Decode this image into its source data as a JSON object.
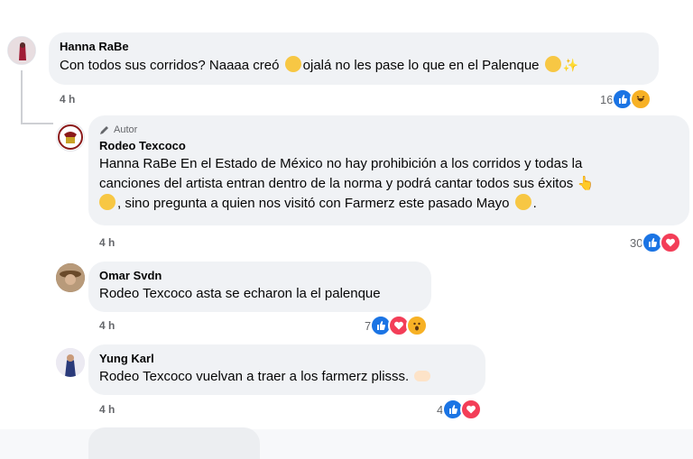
{
  "comments": [
    {
      "name": "Hanna RaBe",
      "text_before_emoji": "Con todos sus corridos? Naaaa creó ",
      "text_after_emoji": "ojalá no les pase lo que en el Palenque ",
      "time": "4 h",
      "reaction_count": "16",
      "reactions": [
        "like-reaction-icon",
        "haha-reaction-icon"
      ]
    },
    {
      "badge": "Autor",
      "name": "Rodeo Texcoco",
      "line1": "Hanna RaBe En el Estado de México no hay prohibición a los corridos y todas la",
      "line2": "canciones del artista entran dentro de la norma y podrá cantar todos sus éxitos ",
      "line3": ", sino pregunta a quien nos visitó con Farmerz este pasado Mayo ",
      "line3_end": ".",
      "time": "4 h",
      "reaction_count": "30",
      "reactions": [
        "like-reaction-icon",
        "love-reaction-icon"
      ]
    },
    {
      "name": "Omar Svdn",
      "text": "Rodeo Texcoco asta se echaron la el palenque",
      "time": "4 h",
      "reaction_count": "7",
      "reactions": [
        "like-reaction-icon",
        "love-reaction-icon",
        "wow-reaction-icon"
      ]
    },
    {
      "name": "Yung Karl",
      "text": "Rodeo Texcoco vuelvan a traer a los farmerz plisss. ",
      "time": "4 h",
      "reaction_count": "4",
      "reactions": [
        "like-reaction-icon",
        "love-reaction-icon"
      ]
    }
  ],
  "colors": {
    "bubble": "#f0f2f5",
    "like": "#1b74e4",
    "love": "#f33e58",
    "secondary_text": "#65676b"
  }
}
